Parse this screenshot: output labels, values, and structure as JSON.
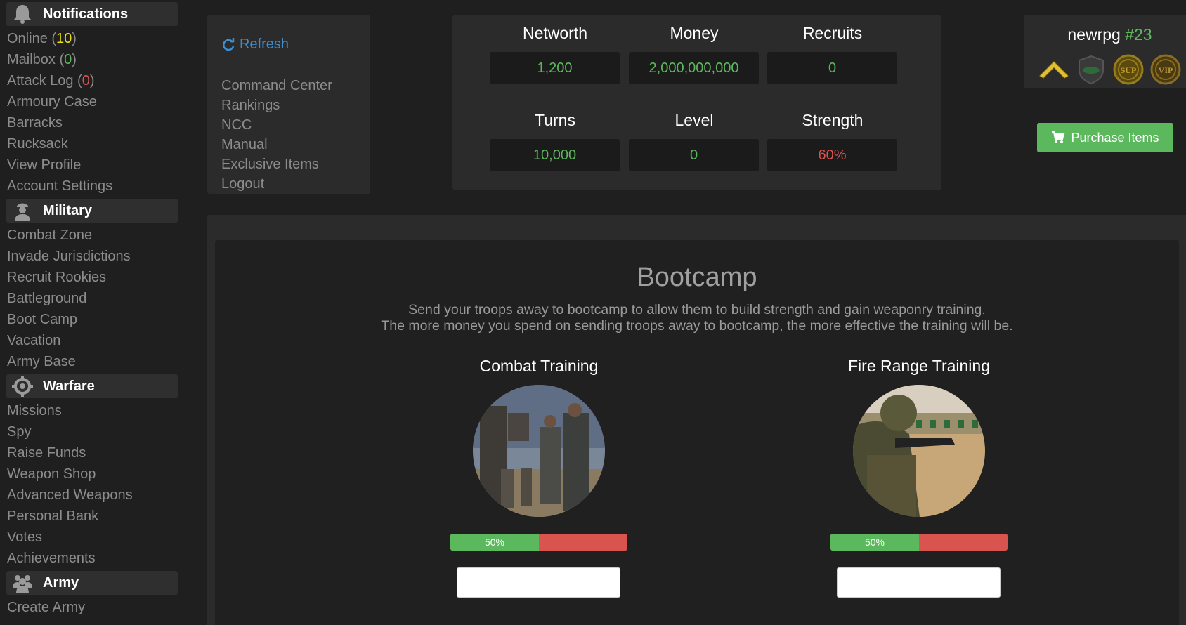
{
  "sidebar": {
    "notifications": {
      "title": "Notifications",
      "items": [
        {
          "label": "Online (",
          "count": "10",
          "suffix": ")",
          "count_color": "yellow"
        },
        {
          "label": "Mailbox (",
          "count": "0",
          "suffix": ")",
          "count_color": "green"
        },
        {
          "label": "Attack Log (",
          "count": "0",
          "suffix": ")",
          "count_color": "red"
        },
        {
          "label": "Armoury Case"
        },
        {
          "label": "Barracks"
        },
        {
          "label": "Rucksack"
        },
        {
          "label": "View Profile"
        },
        {
          "label": "Account Settings"
        }
      ]
    },
    "military": {
      "title": "Military",
      "items": [
        "Combat Zone",
        "Invade Jurisdictions",
        "Recruit Rookies",
        "Battleground",
        "Boot Camp",
        "Vacation",
        "Army Base"
      ]
    },
    "warfare": {
      "title": "Warfare",
      "items": [
        "Missions",
        "Spy",
        "Raise Funds",
        "Weapon Shop",
        "Advanced Weapons",
        "Personal Bank",
        "Votes",
        "Achievements"
      ]
    },
    "army": {
      "title": "Army",
      "items": [
        "Create Army"
      ]
    }
  },
  "quick_menu": {
    "refresh": "Refresh",
    "links": [
      "Command Center",
      "Rankings",
      "NCC",
      "Manual",
      "Exclusive Items",
      "Logout"
    ]
  },
  "stats": {
    "networth": {
      "label": "Networth",
      "value": "1,200"
    },
    "money": {
      "label": "Money",
      "value": "2,000,000,000"
    },
    "recruits": {
      "label": "Recruits",
      "value": "0"
    },
    "turns": {
      "label": "Turns",
      "value": "10,000"
    },
    "level": {
      "label": "Level",
      "value": "0"
    },
    "strength": {
      "label": "Strength",
      "value": "60%"
    }
  },
  "user": {
    "name": "newrpg",
    "rank": "#23",
    "badges": [
      "chevron-rank-icon",
      "police-badge-icon",
      "sup-badge-icon",
      "vip-badge-icon"
    ],
    "badge_text": {
      "sup": "SUP",
      "vip": "VIP"
    }
  },
  "purchase": {
    "label": "Purchase Items"
  },
  "bootcamp": {
    "title": "Bootcamp",
    "desc_line1": "Send your troops away to bootcamp to allow them to build strength and gain weaponry training.",
    "desc_line2": "The more money you spend on sending troops away to bootcamp, the more effective the training will be.",
    "combat": {
      "title": "Combat Training",
      "progress": 50,
      "progress_label": "50%",
      "input_value": ""
    },
    "fire_range": {
      "title": "Fire Range Training",
      "progress": 50,
      "progress_label": "50%",
      "input_value": ""
    }
  },
  "colors": {
    "green": "#5cb85c",
    "red": "#d9534f",
    "yellow": "#f0e010",
    "link_blue": "#3d8fd1",
    "panel": "#2b2b2b",
    "background": "#1f1f1f"
  }
}
